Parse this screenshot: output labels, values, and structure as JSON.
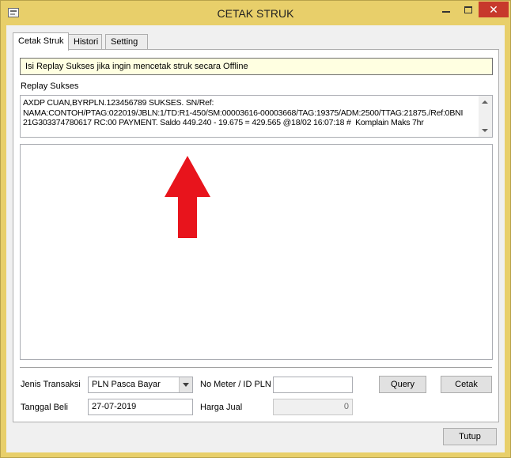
{
  "window": {
    "title": "CETAK STRUK",
    "controls": {
      "minimize": "–",
      "maximize": "□",
      "close": "✕"
    }
  },
  "tabs": [
    {
      "label": "Cetak Struk",
      "active": true
    },
    {
      "label": "Histori",
      "active": false
    },
    {
      "label": "Setting",
      "active": false
    }
  ],
  "info_message": "Isi Replay Sukses jika ingin mencetak struk secara Offline",
  "replay": {
    "label": "Replay Sukses",
    "value": "AXDP CUAN,BYRPLN.123456789 SUKSES. SN/Ref:\nNAMA:CONTOH/PTAG:022019/JBLN:1/TD:R1-450/SM:00003616-00003668/TAG:19375/ADM:2500/TTAG:21875./Ref:0BNI\n21G303374780617 RC:00 PAYMENT. Saldo 449.240 - 19.675 = 429.565 @18/02 16:07:18 #  Komplain Maks 7hr"
  },
  "form": {
    "jenis_transaksi_label": "Jenis Transaksi",
    "jenis_transaksi_value": "PLN Pasca Bayar",
    "tanggal_beli_label": "Tanggal Beli",
    "tanggal_beli_value": "27-07-2019",
    "no_meter_label": "No Meter / ID PLN",
    "no_meter_value": "",
    "harga_jual_label": "Harga Jual",
    "harga_jual_value": "0"
  },
  "buttons": {
    "query": "Query",
    "cetak": "Cetak",
    "tutup": "Tutup"
  },
  "colors": {
    "titlebar": "#e8cf6a",
    "close_button": "#c7392c",
    "info_bar": "#ffffe1",
    "annotation_arrow": "#e8141c"
  },
  "icons": {
    "app": "window-app-icon",
    "annotation": "red-up-arrow-icon"
  }
}
